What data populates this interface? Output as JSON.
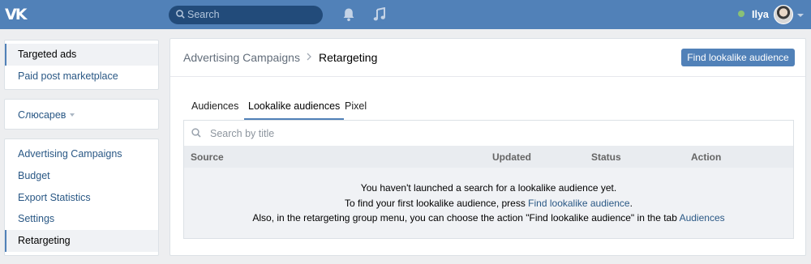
{
  "topbar": {
    "logo": "VK",
    "search_placeholder": "Search",
    "user_name": "Ilya"
  },
  "sidebar": {
    "group1": [
      {
        "label": "Targeted ads",
        "active": true
      },
      {
        "label": "Paid post marketplace",
        "active": false
      }
    ],
    "account": {
      "label": "Слюсарев"
    },
    "group3": [
      {
        "label": "Advertising Campaigns",
        "active": false
      },
      {
        "label": "Budget",
        "active": false
      },
      {
        "label": "Export Statistics",
        "active": false
      },
      {
        "label": "Settings",
        "active": false
      },
      {
        "label": "Retargeting",
        "active": true
      }
    ]
  },
  "main": {
    "breadcrumb": {
      "parent": "Advertising Campaigns",
      "current": "Retargeting"
    },
    "action_button": "Find lookalike audience",
    "tabs": [
      {
        "label": "Audiences",
        "active": false
      },
      {
        "label": "Lookalike audiences",
        "active": true
      },
      {
        "label": "Pixel",
        "active": false
      }
    ],
    "search_placeholder": "Search by title",
    "columns": [
      "Source",
      "Updated",
      "Status",
      "Action"
    ],
    "empty": {
      "line1": "You haven't launched a search for a lookalike audience yet.",
      "line2_pre": "To find your first lookalike audience, press ",
      "line2_link": "Find lookalike audience",
      "line2_post": ".",
      "line3_pre": "Also, in the retargeting group menu, you can choose the action \"Find lookalike audience\" in the tab ",
      "line3_link": "Audiences"
    }
  },
  "colors": {
    "header": "#5181b8",
    "link": "#2a5885",
    "background": "#edeef0"
  }
}
